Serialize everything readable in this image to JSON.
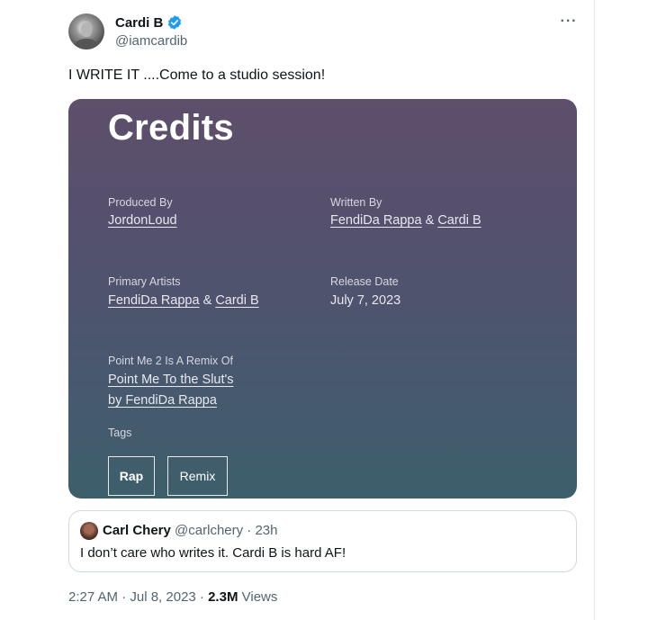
{
  "author": {
    "display_name": "Cardi B",
    "handle": "@iamcardib"
  },
  "tweet": {
    "text": "I WRITE IT ....Come to a studio session!"
  },
  "media": {
    "title": "Credits",
    "produced_by_label": "Produced By",
    "produced_by": "JordonLoud",
    "written_by_label": "Written By",
    "written_by_1": "FendiDa Rappa",
    "amp": "&",
    "written_by_2": "Cardi B",
    "primary_artists_label": "Primary Artists",
    "primary_artist_1": "FendiDa Rappa",
    "primary_artist_2": "Cardi B",
    "release_date_label": "Release Date",
    "release_date": "July 7, 2023",
    "remix_label": "Point Me 2 Is A Remix Of",
    "remix_line1": "Point Me To the Slut's",
    "remix_line2": "by FendiDa Rappa",
    "tags_label": "Tags",
    "tags": [
      "Rap",
      "Remix"
    ]
  },
  "quote": {
    "name": "Carl Chery",
    "meta": "@carlchery · 23h",
    "text": "I don’t care who writes it. Cardi B is hard AF!"
  },
  "footer": {
    "time_date": "2:27 AM · Jul 8, 2023 · ",
    "views_count": "2.3M",
    "views_label": "Views"
  },
  "colors": {
    "verified": "#1d9bf0",
    "secondary_text": "#536471"
  }
}
